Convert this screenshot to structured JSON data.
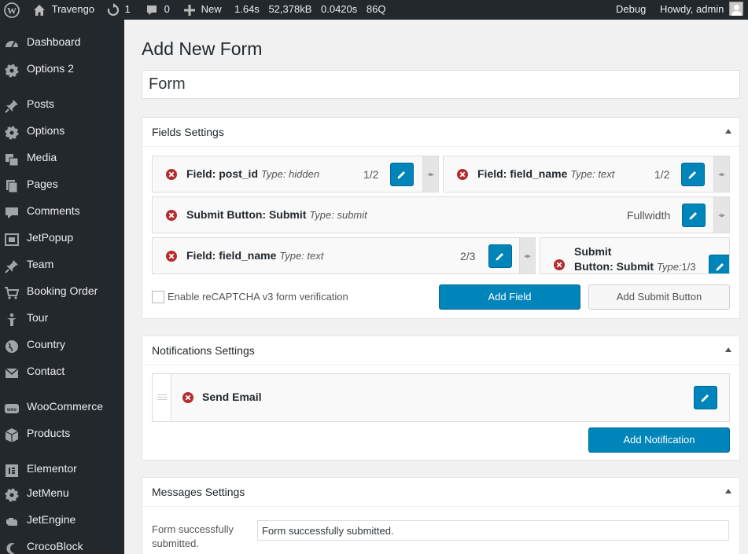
{
  "adminbar": {
    "site_name": "Travengo",
    "updates_count": "1",
    "comments_count": "0",
    "new_label": "New",
    "stats": [
      "1.64s",
      "52,378kB",
      "0.0420s",
      "86Q"
    ],
    "debug_label": "Debug",
    "howdy": "Howdy, admin"
  },
  "sidebar": {
    "items": [
      {
        "label": "Dashboard",
        "icon": "dashboard-icon"
      },
      {
        "label": "Options 2",
        "icon": "gear-icon"
      },
      {
        "label": "Posts",
        "icon": "pin-icon"
      },
      {
        "label": "Options",
        "icon": "gear-icon"
      },
      {
        "label": "Media",
        "icon": "media-icon"
      },
      {
        "label": "Pages",
        "icon": "pages-icon"
      },
      {
        "label": "Comments",
        "icon": "comment-icon"
      },
      {
        "label": "JetPopup",
        "icon": "popup-icon"
      },
      {
        "label": "Team",
        "icon": "pin-icon"
      },
      {
        "label": "Booking Order",
        "icon": "cart-icon"
      },
      {
        "label": "Tour",
        "icon": "tour-icon"
      },
      {
        "label": "Country",
        "icon": "globe-icon"
      },
      {
        "label": "Contact",
        "icon": "envelope-icon"
      },
      {
        "label": "WooCommerce",
        "icon": "woo-icon"
      },
      {
        "label": "Products",
        "icon": "box-icon"
      },
      {
        "label": "Elementor",
        "icon": "elementor-icon"
      },
      {
        "label": "JetMenu",
        "icon": "gear-icon"
      },
      {
        "label": "JetEngine",
        "icon": "engine-icon"
      },
      {
        "label": "CrocoBlock",
        "icon": "croco-icon"
      }
    ]
  },
  "main": {
    "page_title": "Add New Form",
    "form_title_value": "Form"
  },
  "fields_settings": {
    "title": "Fields Settings",
    "fields": [
      {
        "name": "Field: post_id",
        "type": "Type: hidden",
        "width": "1/2"
      },
      {
        "name": "Field: field_name",
        "type": "Type: text",
        "width": "1/2"
      },
      {
        "name": "Submit Button: Submit",
        "type": "Type: submit",
        "width": "Fullwidth"
      },
      {
        "name": "Field: field_name",
        "type": "Type: text",
        "width": "2/3"
      },
      {
        "name_line1": "Submit",
        "name_line2": "Button: Submit",
        "type": "Type:",
        "width": "1/3"
      }
    ],
    "recaptcha_label": "Enable reCAPTCHA v3 form verification",
    "recaptcha_checked": false,
    "add_field_label": "Add Field",
    "add_submit_label": "Add Submit Button"
  },
  "notifications_settings": {
    "title": "Notifications Settings",
    "items": [
      {
        "name": "Send Email"
      }
    ],
    "add_label": "Add Notification"
  },
  "messages_settings": {
    "title": "Messages Settings",
    "success_label": "Form successfully submitted.",
    "success_label_line1": "Form successfully",
    "success_label_line2": "submitted.",
    "success_value": "Form successfully submitted."
  },
  "colors": {
    "primary": "#0085ba",
    "delete": "#b32d2e",
    "sidebar_bg": "#23282d"
  }
}
